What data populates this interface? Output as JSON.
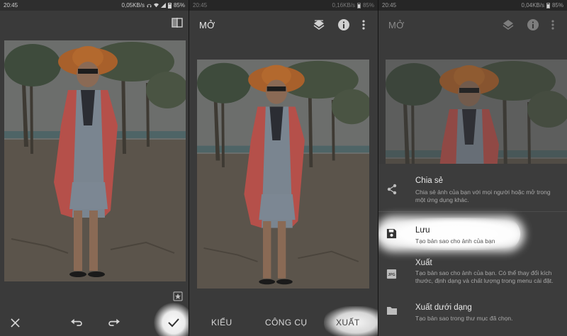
{
  "panels": {
    "left": {
      "status": {
        "time": "20:45",
        "speed": "0,05KB/s",
        "battery": "85%"
      },
      "toolbar": {
        "compare_icon": "compare-icon",
        "star_icon": "star-icon"
      },
      "bottom": {
        "cancel_icon": "close-icon",
        "undo_icon": "undo-icon",
        "redo_icon": "redo-icon",
        "apply_icon": "check-icon"
      }
    },
    "middle": {
      "status": {
        "time": "20:45",
        "speed": "0,16KB/s",
        "battery": "85%"
      },
      "topbar": {
        "title": "MỞ",
        "icons": [
          "layers-icon",
          "info-icon",
          "more-icon"
        ]
      },
      "tabs": [
        "KIỂU",
        "CÔNG CỤ",
        "XUẤT"
      ]
    },
    "right": {
      "status": {
        "time": "20:45",
        "speed": "0,04KB/s",
        "battery": "85%"
      },
      "topbar": {
        "title": "MỞ"
      },
      "menu": [
        {
          "title": "Chia sẻ",
          "desc": "Chia sẻ ảnh của bạn với mọi người hoặc mở trong một ứng dụng khác.",
          "icon": "share-icon"
        },
        {
          "title": "Lưu",
          "desc": "Tạo bản sao cho ảnh của bạn",
          "icon": "save-icon"
        },
        {
          "title": "Xuất",
          "desc": "Tạo bản sao cho ảnh của bạn. Có thể thay đổi kích thước, định dạng và chất lượng trong menu cài đặt.",
          "icon": "jpg-icon"
        },
        {
          "title": "Xuất dưới dạng",
          "desc": "Tạo bản sao trong thư mục đã chọn.",
          "icon": "folder-icon"
        }
      ]
    }
  },
  "colors": {
    "dim_bg": "#3a3a3a",
    "highlight": "#ffffff",
    "coat": "#b8524a",
    "hat": "#b9692c"
  }
}
